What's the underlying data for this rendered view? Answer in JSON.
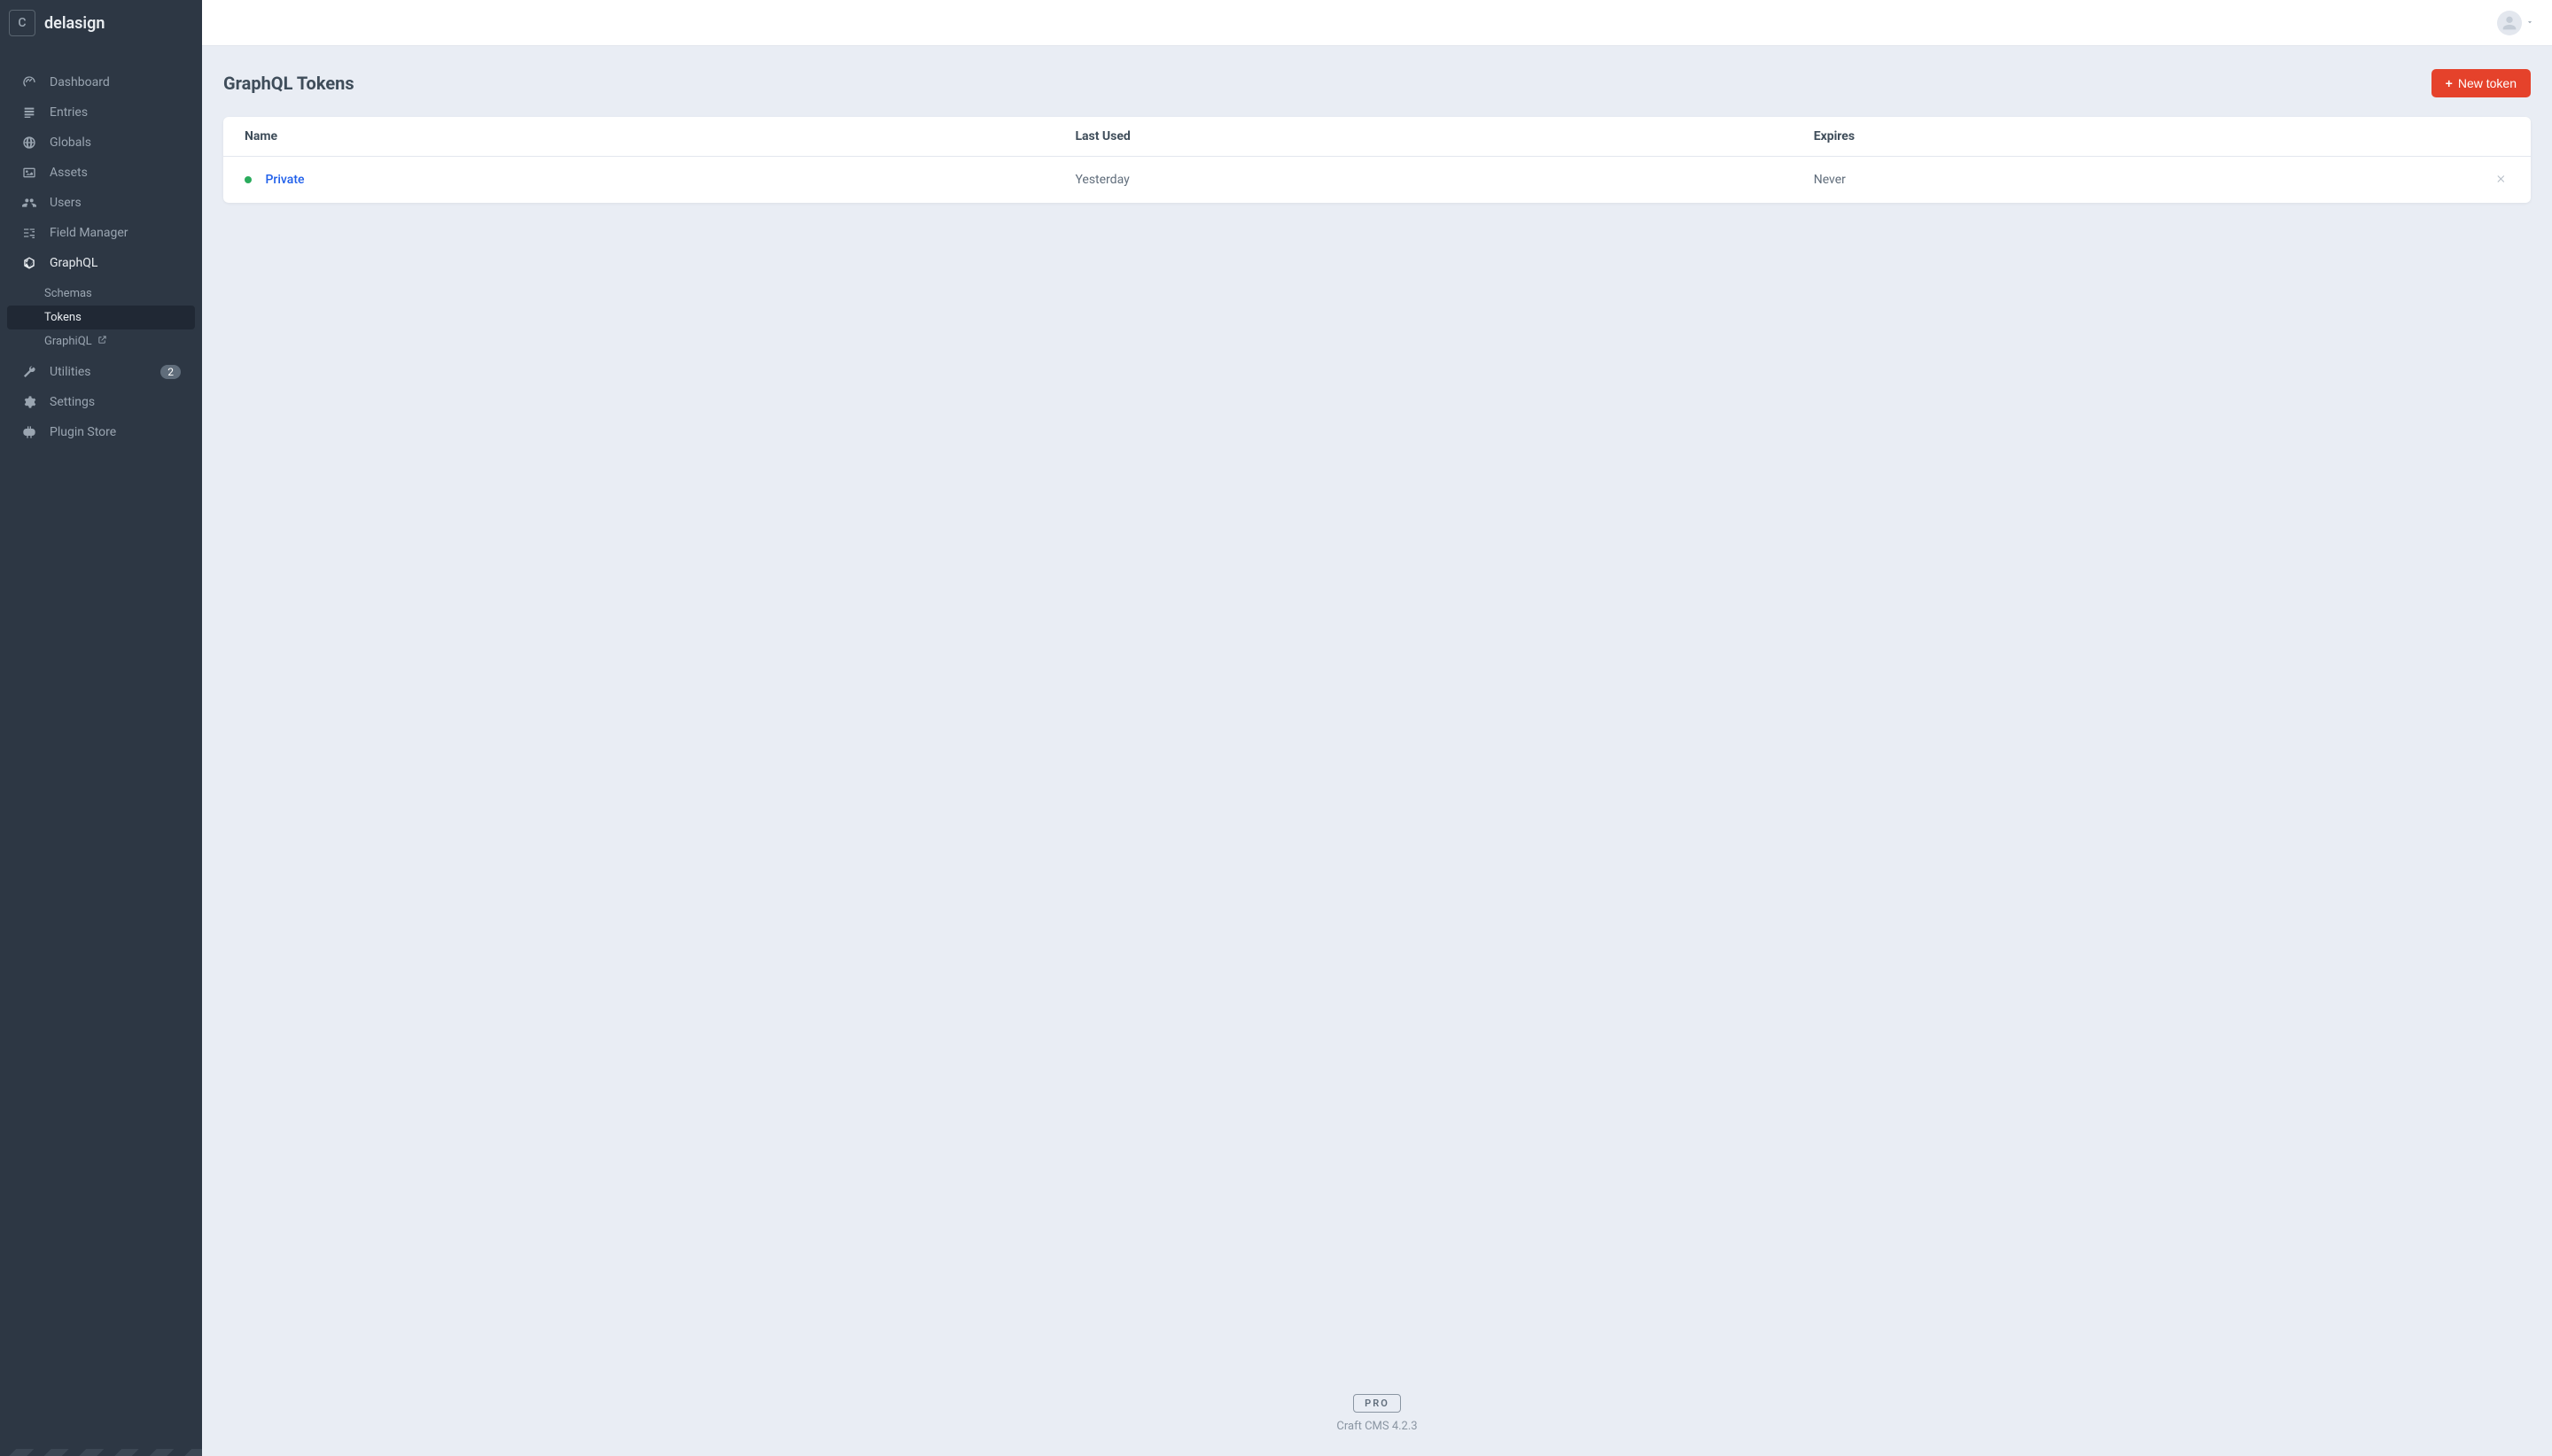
{
  "sidebar": {
    "logo_letter": "C",
    "site_name": "delasign",
    "items": [
      {
        "label": "Dashboard"
      },
      {
        "label": "Entries"
      },
      {
        "label": "Globals"
      },
      {
        "label": "Assets"
      },
      {
        "label": "Users"
      },
      {
        "label": "Field Manager"
      },
      {
        "label": "GraphQL"
      },
      {
        "label": "Utilities",
        "badge": "2"
      },
      {
        "label": "Settings"
      },
      {
        "label": "Plugin Store"
      }
    ],
    "sub_items": [
      {
        "label": "Schemas"
      },
      {
        "label": "Tokens"
      },
      {
        "label": "GraphiQL"
      }
    ]
  },
  "page": {
    "title": "GraphQL Tokens",
    "new_token_label": "New token"
  },
  "table": {
    "headers": {
      "name": "Name",
      "last_used": "Last Used",
      "expires": "Expires"
    },
    "rows": [
      {
        "name": "Private",
        "last_used": "Yesterday",
        "expires": "Never",
        "status": "active"
      }
    ]
  },
  "footer": {
    "badge": "PRO",
    "version": "Craft CMS 4.2.3"
  }
}
